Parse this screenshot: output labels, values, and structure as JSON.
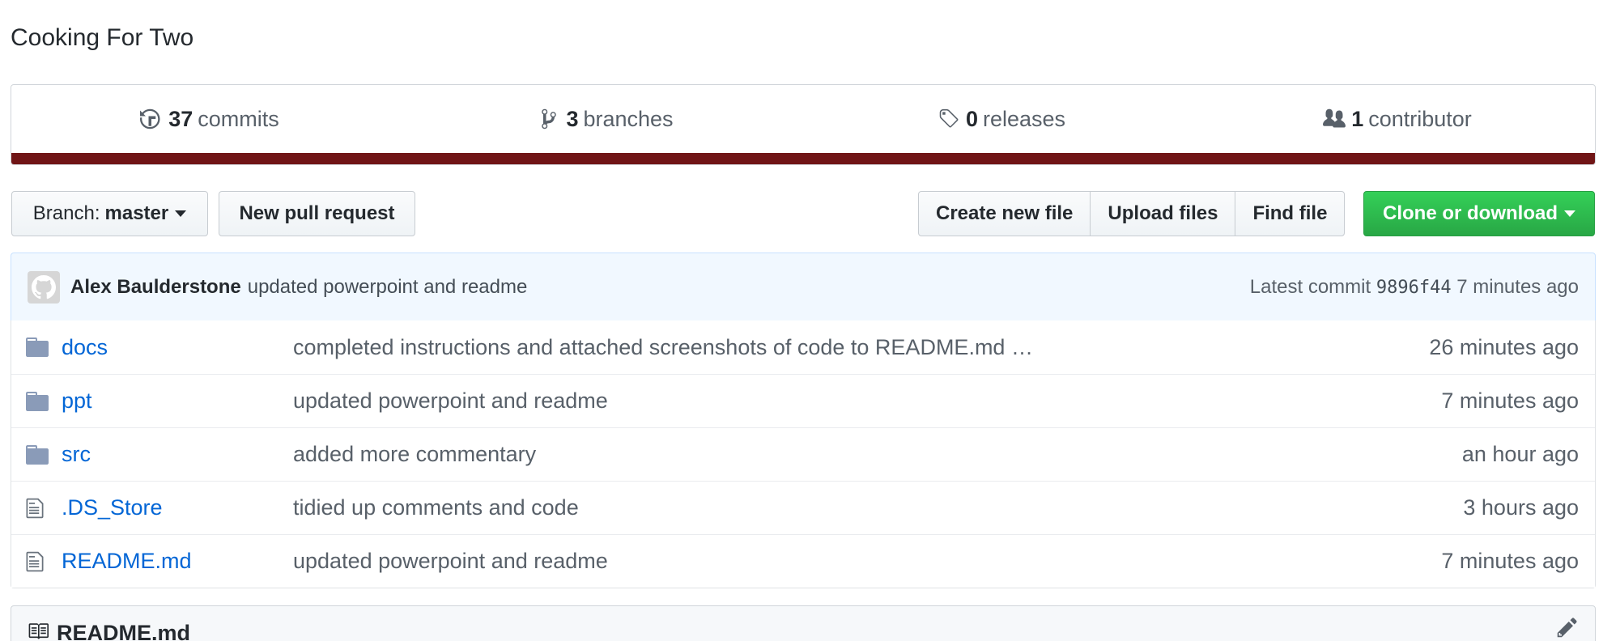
{
  "repo": {
    "description": "Cooking For Two"
  },
  "summary": {
    "commits": {
      "count": "37",
      "label": "commits",
      "icon": "history-icon"
    },
    "branches": {
      "count": "3",
      "label": "branches",
      "icon": "branch-icon"
    },
    "releases": {
      "count": "0",
      "label": "releases",
      "icon": "tag-icon"
    },
    "contributors": {
      "count": "1",
      "label": "contributor",
      "icon": "people-icon"
    },
    "language_color": "#701516"
  },
  "toolbar": {
    "branch_prefix": "Branch:",
    "branch_name": "master",
    "new_pull_request": "New pull request",
    "create_new_file": "Create new file",
    "upload_files": "Upload files",
    "find_file": "Find file",
    "clone_or_download": "Clone or download"
  },
  "latest_commit": {
    "author": "Alex Baulderstone",
    "message": "updated powerpoint and readme",
    "label": "Latest commit",
    "sha": "9896f44",
    "age": "7 minutes ago"
  },
  "files": [
    {
      "type": "dir",
      "name": "docs",
      "message": "completed instructions and attached screenshots of code to README.md …",
      "age": "26 minutes ago"
    },
    {
      "type": "dir",
      "name": "ppt",
      "message": "updated powerpoint and readme",
      "age": "7 minutes ago"
    },
    {
      "type": "dir",
      "name": "src",
      "message": "added more commentary",
      "age": "an hour ago"
    },
    {
      "type": "file",
      "name": ".DS_Store",
      "message": "tidied up comments and code",
      "age": "3 hours ago"
    },
    {
      "type": "file",
      "name": "README.md",
      "message": "updated powerpoint and readme",
      "age": "7 minutes ago"
    }
  ],
  "readme": {
    "title": "README.md"
  },
  "colors": {
    "link": "#0366d6",
    "clone_button": "#28a745",
    "commit_bg": "#f1f8ff"
  }
}
